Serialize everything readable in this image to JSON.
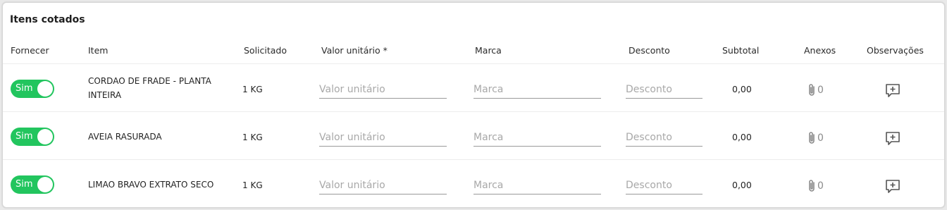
{
  "title": "Itens cotados",
  "headers": {
    "fornecer": "Fornecer",
    "item": "Item",
    "solicitado": "Solicitado",
    "valor_unitario": "Valor unitário *",
    "marca": "Marca",
    "desconto": "Desconto",
    "subtotal": "Subtotal",
    "anexos": "Anexos",
    "observacoes": "Observações"
  },
  "placeholders": {
    "valor_unitario": "Valor unitário",
    "marca": "Marca",
    "desconto": "Desconto"
  },
  "rows": [
    {
      "fornecer": "Sim",
      "item": "CORDAO DE FRADE - PLANTA INTEIRA",
      "solicitado": "1 KG",
      "subtotal": "0,00",
      "anexos": "0"
    },
    {
      "fornecer": "Sim",
      "item": "AVEIA RASURADA",
      "solicitado": "1 KG",
      "subtotal": "0,00",
      "anexos": "0"
    },
    {
      "fornecer": "Sim",
      "item": "LIMAO BRAVO EXTRATO SECO",
      "solicitado": "1 KG",
      "subtotal": "0,00",
      "anexos": "0"
    }
  ],
  "icons": {
    "attach": "paperclip-icon",
    "observation": "add-comment-icon"
  },
  "colors": {
    "toggle_on": "#22c55e"
  }
}
